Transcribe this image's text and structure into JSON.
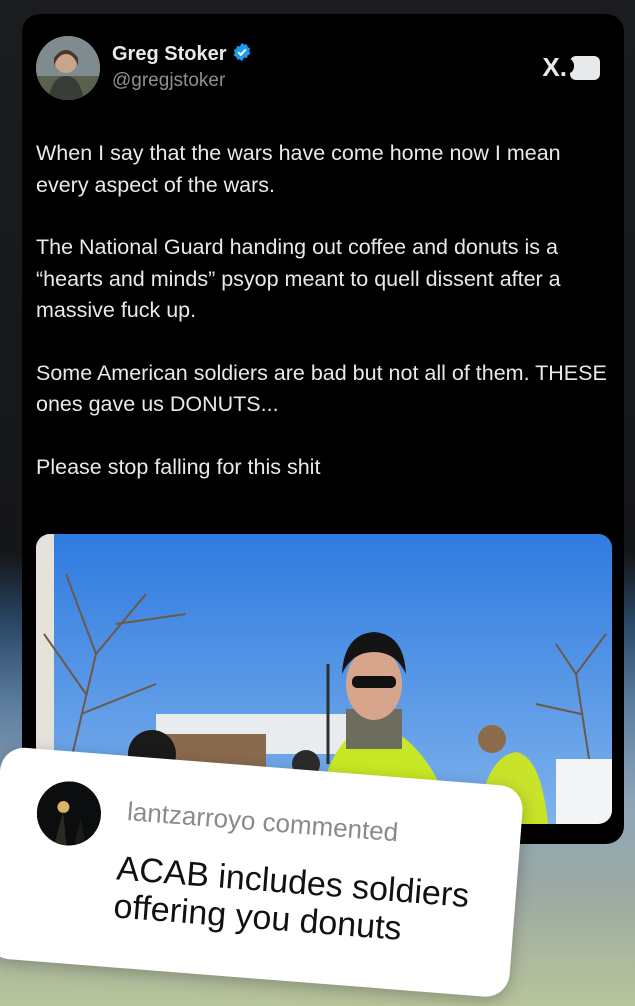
{
  "post": {
    "author_name": "Greg Stoker",
    "author_handle": "@gregjstoker",
    "platform_logo": "X.",
    "paragraphs": [
      "When I say that the wars have come home now I mean every aspect of the wars.",
      "The National Guard handing out coffee and donuts is a “hearts and minds” psyop meant to quell dissent after a massive fuck up.",
      "Some American soldiers are bad but not all of them. THESE ones gave us DONUTS...",
      "Please stop falling for this shit"
    ]
  },
  "comment": {
    "username": "lantzarroyo",
    "action": "commented",
    "text": "ACAB includes soldiers offering you donuts"
  },
  "colors": {
    "verified_blue": "#1d9bf0",
    "card_background": "#000000",
    "comment_background": "#ffffff"
  },
  "icons": [
    "verified-badge-icon",
    "x-logo-icon",
    "speech-bubble-icon"
  ]
}
